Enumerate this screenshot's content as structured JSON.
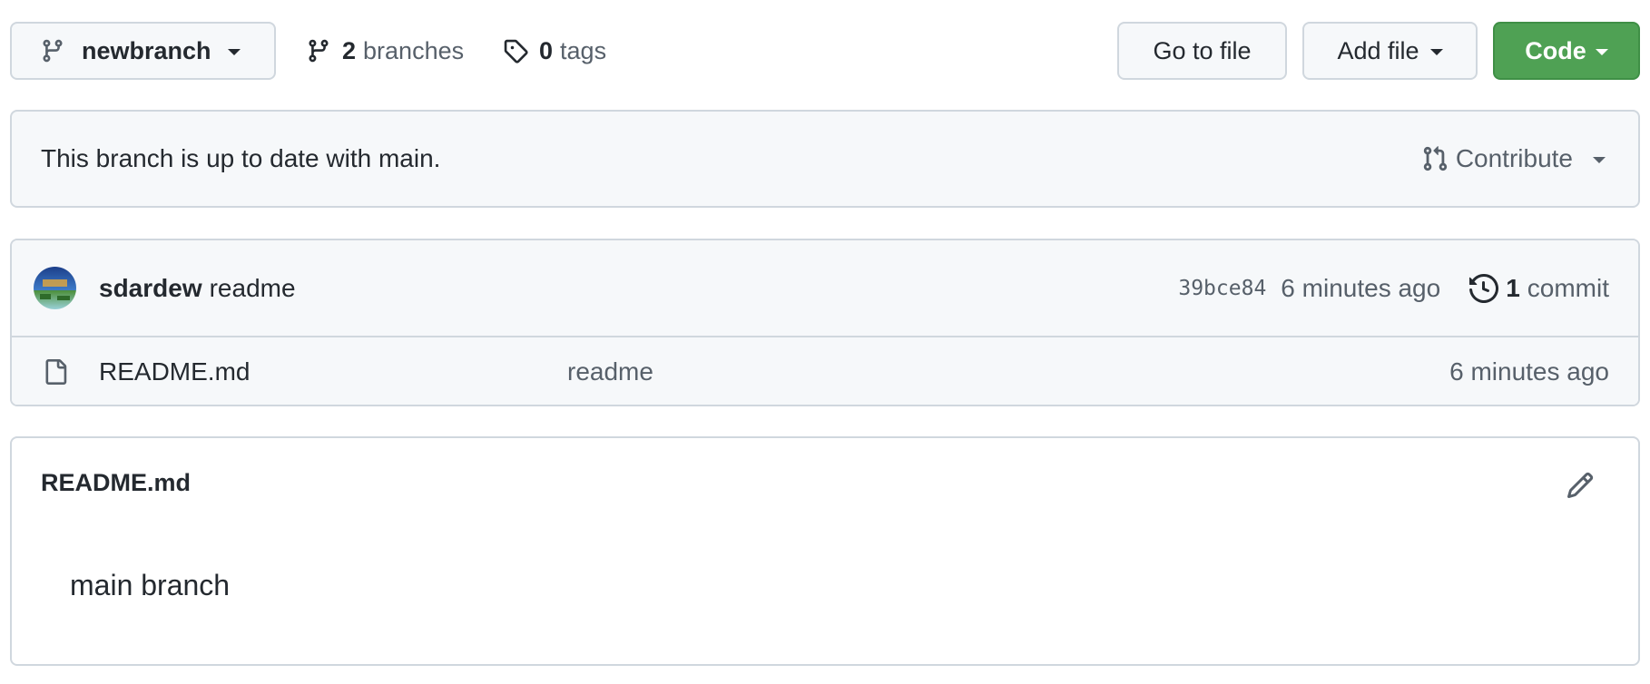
{
  "toolbar": {
    "branch_selector": {
      "label": "newbranch",
      "icon": "git-branch-icon"
    },
    "branches": {
      "count": "2",
      "label": "branches",
      "icon": "git-branch-icon"
    },
    "tags": {
      "count": "0",
      "label": "tags",
      "icon": "tag-icon"
    },
    "go_to_file_label": "Go to file",
    "add_file_label": "Add file",
    "code_label": "Code"
  },
  "banner": {
    "message": "This branch is up to date with main.",
    "contribute_label": "Contribute",
    "contribute_icon": "git-pull-request-icon"
  },
  "latest_commit": {
    "author": "sdardew",
    "message": "readme",
    "sha": "39bce84",
    "time": "6 minutes ago",
    "commit_count": "1",
    "commit_label": "commit",
    "history_icon": "history-icon"
  },
  "files": [
    {
      "name": "README.md",
      "commit_message": "readme",
      "time": "6 minutes ago",
      "icon": "file-icon"
    }
  ],
  "readme": {
    "title": "README.md",
    "edit_icon": "pencil-icon",
    "content": "main branch"
  },
  "colors": {
    "accent_green": "#4fa154",
    "border": "#d0d7de",
    "muted_text": "#57606a",
    "panel_bg": "#f6f8fa"
  }
}
